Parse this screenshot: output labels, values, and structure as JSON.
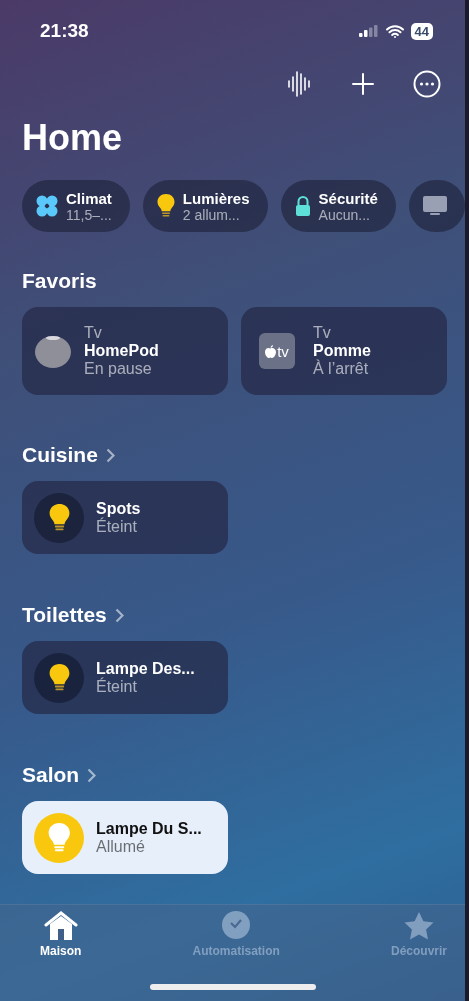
{
  "status_bar": {
    "time": "21:38",
    "battery": "44"
  },
  "title": "Home",
  "categories": [
    {
      "kind": "fan",
      "label": "Climat",
      "detail": "11,5–..."
    },
    {
      "kind": "bulb",
      "label": "Lumières",
      "detail": "2 allum..."
    },
    {
      "kind": "lock",
      "label": "Sécurité",
      "detail": "Aucun..."
    },
    {
      "kind": "tv"
    }
  ],
  "favorites": {
    "title": "Favoris",
    "items": [
      {
        "kind": "homepod",
        "room": "Tv",
        "name": "HomePod",
        "status": "En pause"
      },
      {
        "kind": "appletv",
        "badge": "tv",
        "room": "Tv",
        "name": "Pomme",
        "status": "À l’arrêt"
      }
    ]
  },
  "rooms": [
    {
      "title": "Cuisine",
      "accessories": [
        {
          "name": "Spots",
          "status": "Éteint",
          "on": false
        }
      ]
    },
    {
      "title": "Toilettes",
      "accessories": [
        {
          "name": "Lampe Des...",
          "status": "Éteint",
          "on": false
        }
      ]
    },
    {
      "title": "Salon",
      "accessories": [
        {
          "name": "Lampe Du S...",
          "status": "Allumé",
          "on": true
        }
      ]
    }
  ],
  "tabs": [
    {
      "kind": "home",
      "label": "Maison",
      "selected": true
    },
    {
      "kind": "clock",
      "label": "Automatisation",
      "selected": false
    },
    {
      "kind": "star",
      "label": "Découvrir",
      "selected": false
    }
  ]
}
